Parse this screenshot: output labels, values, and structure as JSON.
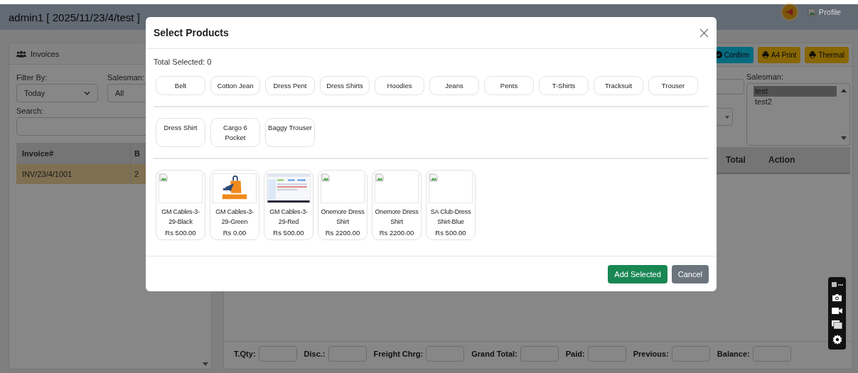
{
  "header": {
    "title": "admin1 [ 2025/11/23/4/test ]",
    "profile_label": "Profile"
  },
  "left_panel": {
    "title": "Invoices",
    "filter_label": "Filter By:",
    "filter_value": "Today",
    "salesman_label": "Salesman:",
    "salesman_value": "All",
    "search_label": "Search:",
    "columns": [
      "Invoice#",
      "B"
    ],
    "rows": [
      {
        "cells": [
          "INV/23/4/1001",
          "2"
        ],
        "selected": true
      }
    ]
  },
  "right_panel": {
    "buttons": [
      {
        "label": "Confirm",
        "kind": "confirm"
      },
      {
        "label": "A4 Print",
        "kind": "print"
      },
      {
        "label": "Thermal",
        "kind": "print"
      }
    ],
    "salesman_label": "Salesman:",
    "salesman_options": [
      {
        "label": "test",
        "selected": true
      },
      {
        "label": "test2",
        "selected": false
      }
    ],
    "columns": [
      "Total",
      "Action"
    ],
    "totals": [
      "T.Qty:",
      "Disc.:",
      "Freight Chrg:",
      "Grand Total:",
      "Paid:",
      "Previous:",
      "Balance:"
    ]
  },
  "modal": {
    "title": "Select Products",
    "total_selected": "Total Selected: 0",
    "categories": [
      "Belt",
      "Cotton Jean",
      "Dress Pent",
      "Dress Shirts",
      "Hoodies",
      "Jeans",
      "Pents",
      "T-Shirts",
      "Tracksuit",
      "Trouser"
    ],
    "subcategories": [
      "Dress Shirt",
      "Cargo 6 Pocket",
      "Baggy Trouser"
    ],
    "products": [
      {
        "name": "GM Cables-3-29-Black",
        "price": "Rs 500.00",
        "kind": "broken"
      },
      {
        "name": "GM Cables-3-29-Green",
        "price": "Rs 0.00",
        "kind": "logo"
      },
      {
        "name": "GM Cables-3-29-Red",
        "price": "Rs 500.00",
        "kind": "screenshot"
      },
      {
        "name": "Onemore Dress Shirt",
        "price": "Rs 2200.00",
        "kind": "broken"
      },
      {
        "name": "Onemore Dress Shirt",
        "price": "Rs 2200.00",
        "kind": "broken"
      },
      {
        "name": "SA Club-Dress Shirt-Blue",
        "price": "Rs 500.00",
        "kind": "broken"
      }
    ],
    "buttons": [
      {
        "label": "Add Selected",
        "kind": "primary"
      },
      {
        "label": "Cancel",
        "kind": "secondary"
      }
    ]
  }
}
